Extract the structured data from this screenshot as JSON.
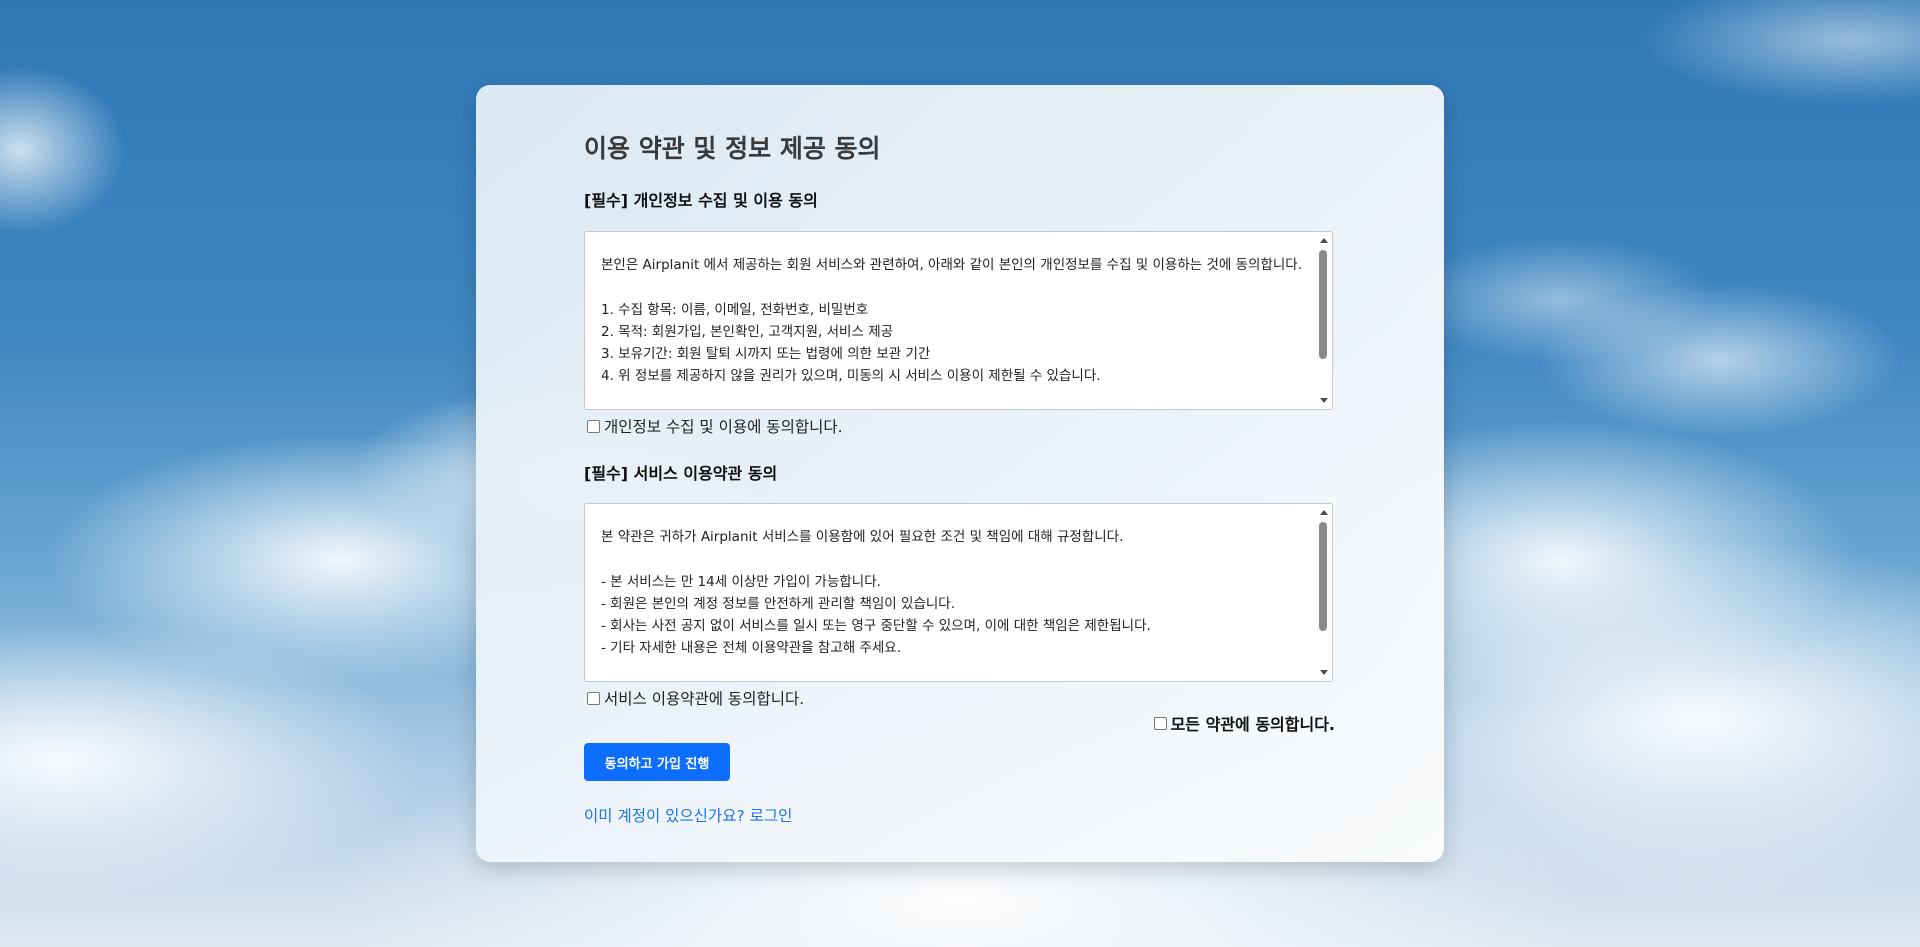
{
  "page": {
    "title": "이용 약관 및 정보 제공 동의"
  },
  "privacy": {
    "heading": "[필수] 개인정보 수집 및 이용 동의",
    "lines": [
      "본인은 Airplanit 에서 제공하는 회원 서비스와 관련하여, 아래와 같이 본인의 개인정보를 수집 및 이용하는 것에 동의합니다.",
      "",
      "1. 수집 항목: 이름, 이메일, 전화번호, 비밀번호",
      "2. 목적: 회원가입, 본인확인, 고객지원, 서비스 제공",
      "3. 보유기간: 회원 탈퇴 시까지 또는 법령에 의한 보관 기간",
      "4. 위 정보를 제공하지 않을 권리가 있으며, 미동의 시 서비스 이용이 제한될 수 있습니다."
    ],
    "checkbox_label": "개인정보 수집 및 이용에 동의합니다."
  },
  "service": {
    "heading": "[필수] 서비스 이용약관 동의",
    "lines": [
      "본 약관은 귀하가 Airplanit 서비스를 이용함에 있어 필요한 조건 및 책임에 대해 규정합니다.",
      "",
      "- 본 서비스는 만 14세 이상만 가입이 가능합니다.",
      "- 회원은 본인의 계정 정보를 안전하게 관리할 책임이 있습니다.",
      "- 회사는 사전 공지 없이 서비스를 일시 또는 영구 중단할 수 있으며, 이에 대한 책임은 제한됩니다.",
      "- 기타 자세한 내용은 전체 이용약관을 참고해 주세요."
    ],
    "checkbox_label": "서비스 이용약관에 동의합니다."
  },
  "agree_all_label": "모든 약관에 동의합니다.",
  "submit_label": "동의하고 가입 진행",
  "login_link_text": "이미 계정이 있으신가요? 로그인"
}
